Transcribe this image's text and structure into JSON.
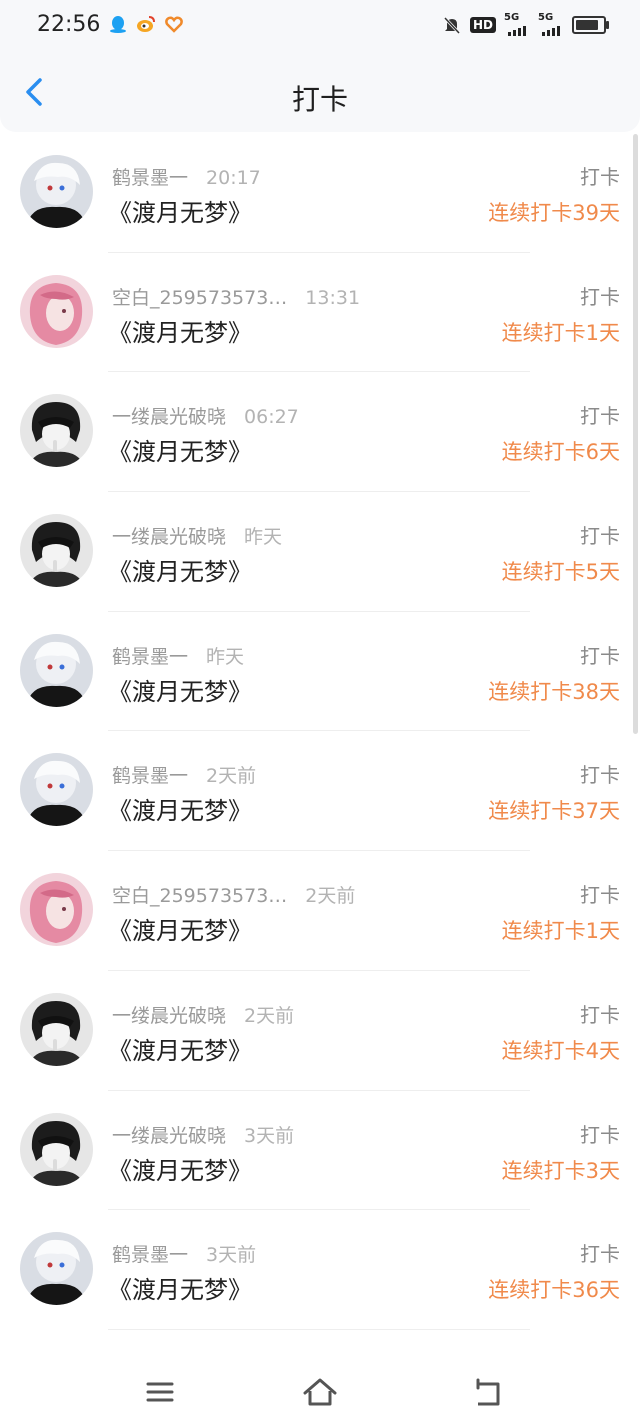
{
  "status_bar": {
    "time": "22:56",
    "left_icons": [
      "qq-icon",
      "weibo-icon",
      "app-heart-icon"
    ],
    "right_icons": [
      "silent-bell-icon",
      "hd-icon",
      "signal-5g-icon",
      "signal-5g-icon",
      "battery-icon"
    ],
    "hd_label": "HD",
    "signal_label": "5G"
  },
  "header": {
    "title": "打卡",
    "back_icon": "chevron-left-icon",
    "accent": "#2a8ef0"
  },
  "colors": {
    "streak": "#f08a4b",
    "name": "#9a9a9a",
    "title": "#222222"
  },
  "items": [
    {
      "user": "鹤景墨一",
      "time": "20:17",
      "book": "《渡月无梦》",
      "action": "打卡",
      "streak": "连续打卡39天",
      "avatar": "white-hair"
    },
    {
      "user": "空白_259573573…",
      "time": "13:31",
      "book": "《渡月无梦》",
      "action": "打卡",
      "streak": "连续打卡1天",
      "avatar": "pink-hair"
    },
    {
      "user": "一缕晨光破晓",
      "time": "06:27",
      "book": "《渡月无梦》",
      "action": "打卡",
      "streak": "连续打卡6天",
      "avatar": "dark-hair"
    },
    {
      "user": "一缕晨光破晓",
      "time": "昨天",
      "book": "《渡月无梦》",
      "action": "打卡",
      "streak": "连续打卡5天",
      "avatar": "dark-hair"
    },
    {
      "user": "鹤景墨一",
      "time": "昨天",
      "book": "《渡月无梦》",
      "action": "打卡",
      "streak": "连续打卡38天",
      "avatar": "white-hair"
    },
    {
      "user": "鹤景墨一",
      "time": "2天前",
      "book": "《渡月无梦》",
      "action": "打卡",
      "streak": "连续打卡37天",
      "avatar": "white-hair"
    },
    {
      "user": "空白_259573573…",
      "time": "2天前",
      "book": "《渡月无梦》",
      "action": "打卡",
      "streak": "连续打卡1天",
      "avatar": "pink-hair"
    },
    {
      "user": "一缕晨光破晓",
      "time": "2天前",
      "book": "《渡月无梦》",
      "action": "打卡",
      "streak": "连续打卡4天",
      "avatar": "dark-hair"
    },
    {
      "user": "一缕晨光破晓",
      "time": "3天前",
      "book": "《渡月无梦》",
      "action": "打卡",
      "streak": "连续打卡3天",
      "avatar": "dark-hair"
    },
    {
      "user": "鹤景墨一",
      "time": "3天前",
      "book": "《渡月无梦》",
      "action": "打卡",
      "streak": "连续打卡36天",
      "avatar": "white-hair"
    }
  ],
  "nav": {
    "icons": [
      "menu-icon",
      "home-icon",
      "back-icon"
    ]
  }
}
